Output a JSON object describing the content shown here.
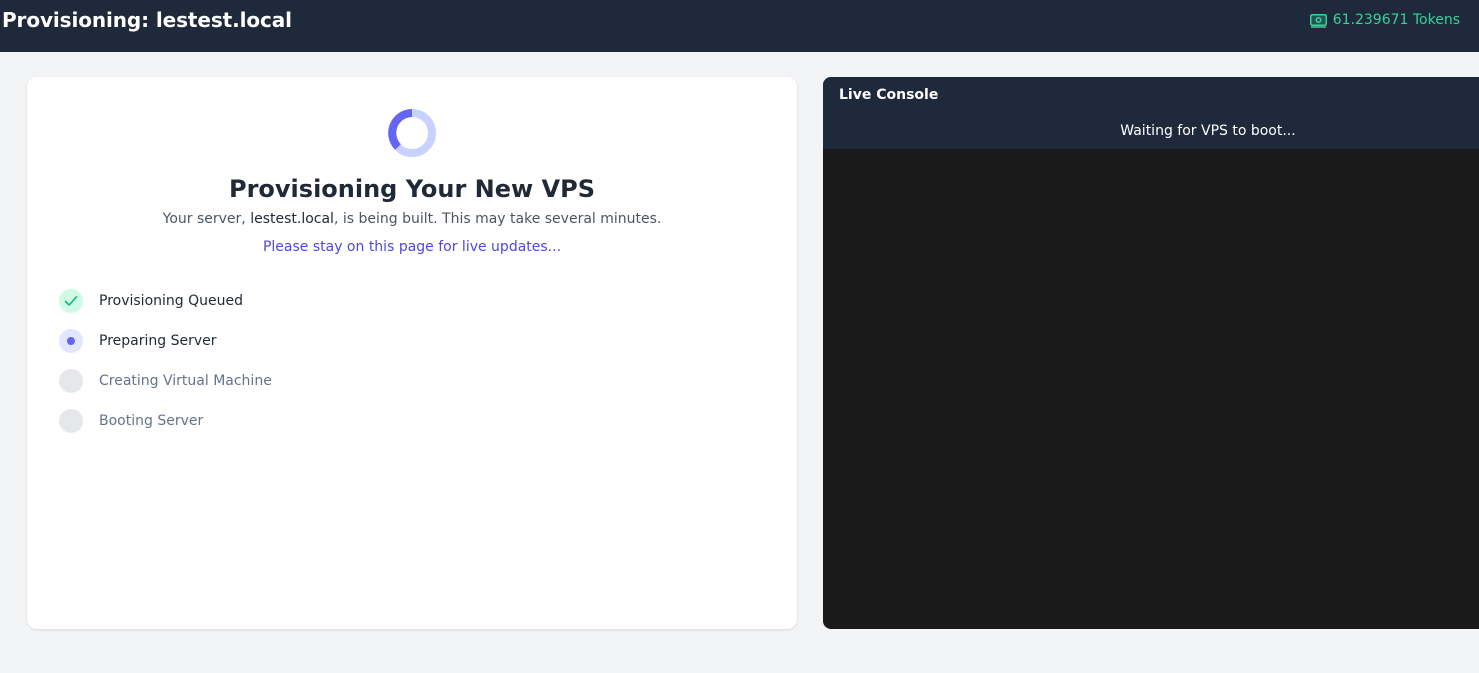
{
  "header": {
    "title": "Provisioning: lestest.local",
    "tokens_label": "61.239671 Tokens",
    "tokens_icon": "money-bill-icon"
  },
  "status_card": {
    "heading": "Provisioning Your New VPS",
    "sub_prefix": "Your server, ",
    "hostname": "lestest.local",
    "sub_suffix": ", is being built. This may take several minutes.",
    "stay_message": "Please stay on this page for live updates...",
    "steps": [
      {
        "label": "Provisioning Queued",
        "state": "done",
        "icon": "check-icon"
      },
      {
        "label": "Preparing Server",
        "state": "active",
        "icon": "active-dot-icon"
      },
      {
        "label": "Creating Virtual Machine",
        "state": "pending",
        "icon": "pending-circle-icon"
      },
      {
        "label": "Booting Server",
        "state": "pending",
        "icon": "pending-circle-icon"
      }
    ]
  },
  "console": {
    "title": "Live Console",
    "status": "Waiting for VPS to boot..."
  },
  "colors": {
    "header_bg": "#1e293b",
    "accent": "#4f46e5",
    "tokens": "#34d399",
    "console_bg": "#1a1a1a"
  }
}
